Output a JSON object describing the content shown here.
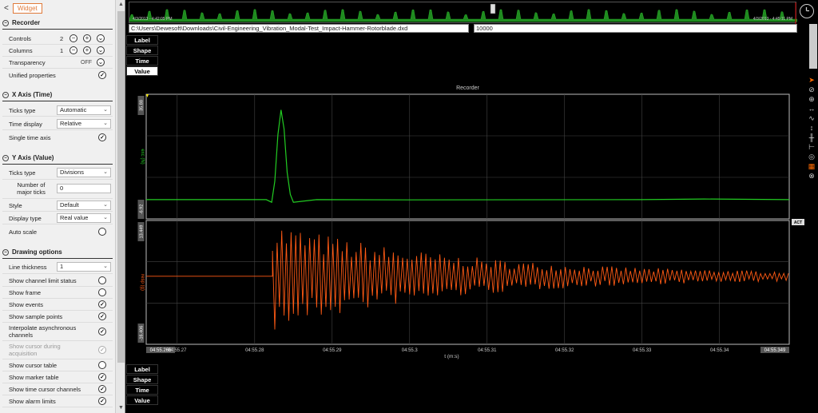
{
  "widget": {
    "back_icon": "chevron-left-icon",
    "tab_label": "Widget"
  },
  "recorder": {
    "title": "Recorder",
    "controls_label": "Controls",
    "controls_value": "2",
    "columns_label": "Columns",
    "columns_value": "1",
    "transparency_label": "Transparency",
    "transparency_value": "OFF",
    "unified_label": "Unified properties"
  },
  "x_axis": {
    "title": "X Axis (Time)",
    "ticks_type_label": "Ticks type",
    "ticks_type_value": "Automatic",
    "time_display_label": "Time display",
    "time_display_value": "Relative",
    "single_time_label": "Single time axis"
  },
  "y_axis": {
    "title": "Y Axis (Value)",
    "ticks_type_label": "Ticks type",
    "ticks_type_value": "Divisions",
    "major_ticks_label_1": "Number of",
    "major_ticks_label_2": "major ticks",
    "major_ticks_value": "0",
    "style_label": "Style",
    "style_value": "Default",
    "display_type_label": "Display type",
    "display_type_value": "Real value",
    "auto_scale_label": "Auto scale"
  },
  "drawing": {
    "title": "Drawing options",
    "line_thickness_label": "Line thickness",
    "line_thickness_value": "1",
    "items": [
      {
        "label": "Show channel limit status",
        "checked": false
      },
      {
        "label": "Show frame",
        "checked": false
      },
      {
        "label": "Show events",
        "checked": true
      },
      {
        "label": "Show sample points",
        "checked": true
      },
      {
        "label": "Interpolate asynchronous",
        "label2": "channels",
        "checked": true
      },
      {
        "label": "Show cursor during",
        "label2": "acquisition",
        "checked": true,
        "disabled": true
      },
      {
        "label": "Show cursor table",
        "checked": false
      },
      {
        "label": "Show marker table",
        "checked": true
      },
      {
        "label": "Show time cursor channels",
        "checked": true
      },
      {
        "label": "Show alarm limits",
        "checked": true
      }
    ]
  },
  "overview": {
    "start_time": "4/3/2013 - 4:42:05 PM",
    "end_time": "4/3/2013 - 4:45:11 PM"
  },
  "file_path": "C:\\Users\\Dewesoft\\Downloads\\Civil-Engineering_Vibration_Modal-Test_Impact-Hammer-Rotorblade.dxd",
  "sample_rate": "10000",
  "label_buttons": {
    "label": "Label",
    "shape": "Shape",
    "time": "Time",
    "value": "Value"
  },
  "act": "ACT",
  "colors": {
    "exc": "#22cc22",
    "resp": "#ff5a14",
    "accent": "#e07a3a"
  },
  "chart_data": {
    "type": "line",
    "title": "Recorder",
    "xlabel": "t (m:s)",
    "x_ticks": [
      "04:55.266",
      "04:55.27",
      "04:55.28",
      "04:55.29",
      "04:55.3",
      "04:55.31",
      "04:55.32",
      "04:55.33",
      "04:55.34",
      "04:55.349"
    ],
    "xlim": [
      0.266,
      0.349
    ],
    "series": [
      {
        "name": "exc (N)",
        "ymax_label": "35.88",
        "ymin_label": "-6.92",
        "ylim": [
          -6.92,
          35.88
        ],
        "x": [
          0.266,
          0.2815,
          0.2822,
          0.2826,
          0.283,
          0.2834,
          0.2838,
          0.2842,
          0.2846,
          0.285,
          0.288,
          0.3,
          0.33,
          0.338,
          0.349
        ],
        "values": [
          -0.3,
          -0.3,
          -1.2,
          6,
          22,
          30.5,
          24,
          9,
          1.5,
          -1.2,
          -0.3,
          -0.4,
          -0.3,
          -0.1,
          -0.3
        ]
      },
      {
        "name": "resp (g)",
        "ymax_label": "13.449",
        "ymin_label": "-16.406",
        "ylim": [
          -16.406,
          13.449
        ],
        "x_start": 0.266,
        "x_end": 0.349,
        "onset": 0.2823,
        "flat_value": 0.0,
        "peak_amplitude": 13.0,
        "decay": 0.022,
        "osc_period": 0.0006
      }
    ]
  }
}
